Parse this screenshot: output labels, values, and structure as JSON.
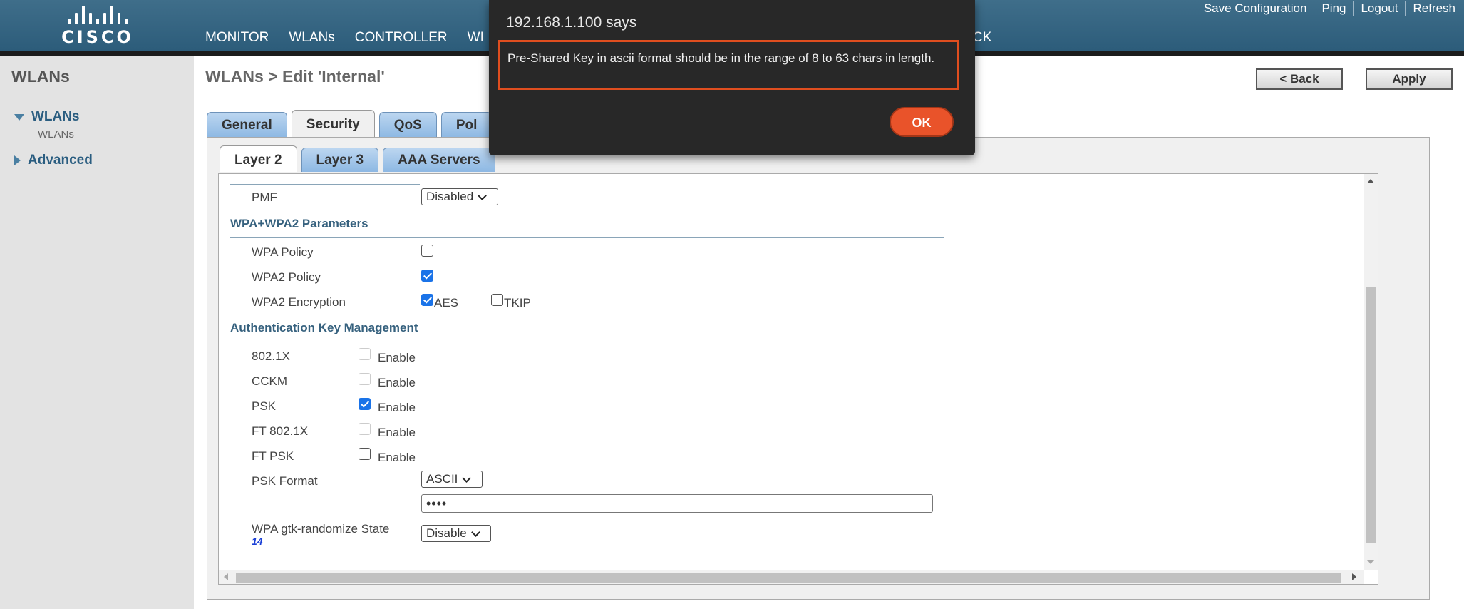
{
  "header": {
    "brand": "CISCO",
    "nav": [
      "MONITOR",
      "WLANs",
      "CONTROLLER",
      "WI"
    ],
    "nav_partial_right": "CK",
    "links": [
      "Save Configuration",
      "Ping",
      "Logout",
      "Refresh"
    ]
  },
  "sidebar": {
    "title": "WLANs",
    "wlans_label": "WLANs",
    "wlans_sub": "WLANs",
    "advanced_label": "Advanced"
  },
  "page": {
    "breadcrumb": "WLANs > Edit   'Internal'",
    "back_label": "< Back",
    "apply_label": "Apply"
  },
  "tabs": [
    "General",
    "Security",
    "QoS",
    "Pol"
  ],
  "subtabs": [
    "Layer 2",
    "Layer 3",
    "AAA Servers"
  ],
  "form": {
    "pmf_label": "PMF",
    "pmf_value": "Disabled",
    "wpa_section": "WPA+WPA2 Parameters",
    "wpa_policy_label": "WPA Policy",
    "wpa2_policy_label": "WPA2 Policy",
    "wpa2_encryption_label": "WPA2 Encryption",
    "aes_label": "AES",
    "tkip_label": "TKIP",
    "akm_section": "Authentication Key Management",
    "akm": [
      {
        "label": "802.1X",
        "enable": "Enable",
        "checked": false
      },
      {
        "label": "CCKM",
        "enable": "Enable",
        "checked": false
      },
      {
        "label": "PSK",
        "enable": "Enable",
        "checked": true
      },
      {
        "label": "FT 802.1X",
        "enable": "Enable",
        "checked": false
      },
      {
        "label": "FT PSK",
        "enable": "Enable",
        "checked": false
      }
    ],
    "psk_format_label": "PSK Format",
    "psk_format_value": "ASCII",
    "psk_value": "••••",
    "gtk_label": "WPA gtk-randomize State",
    "gtk_link": "14",
    "gtk_value": "Disable"
  },
  "dialog": {
    "title": "192.168.1.100 says",
    "message": "Pre-Shared Key in ascii format should be in the range of 8 to 63 chars in length.",
    "ok_label": "OK"
  },
  "colors": {
    "header": "#2c5c7a",
    "accent_underline": "#f4a640",
    "dialog_bg": "#282828",
    "dialog_highlight": "#e04e1f",
    "ok_button": "#e9532a",
    "checkbox_checked": "#1a73e8"
  }
}
